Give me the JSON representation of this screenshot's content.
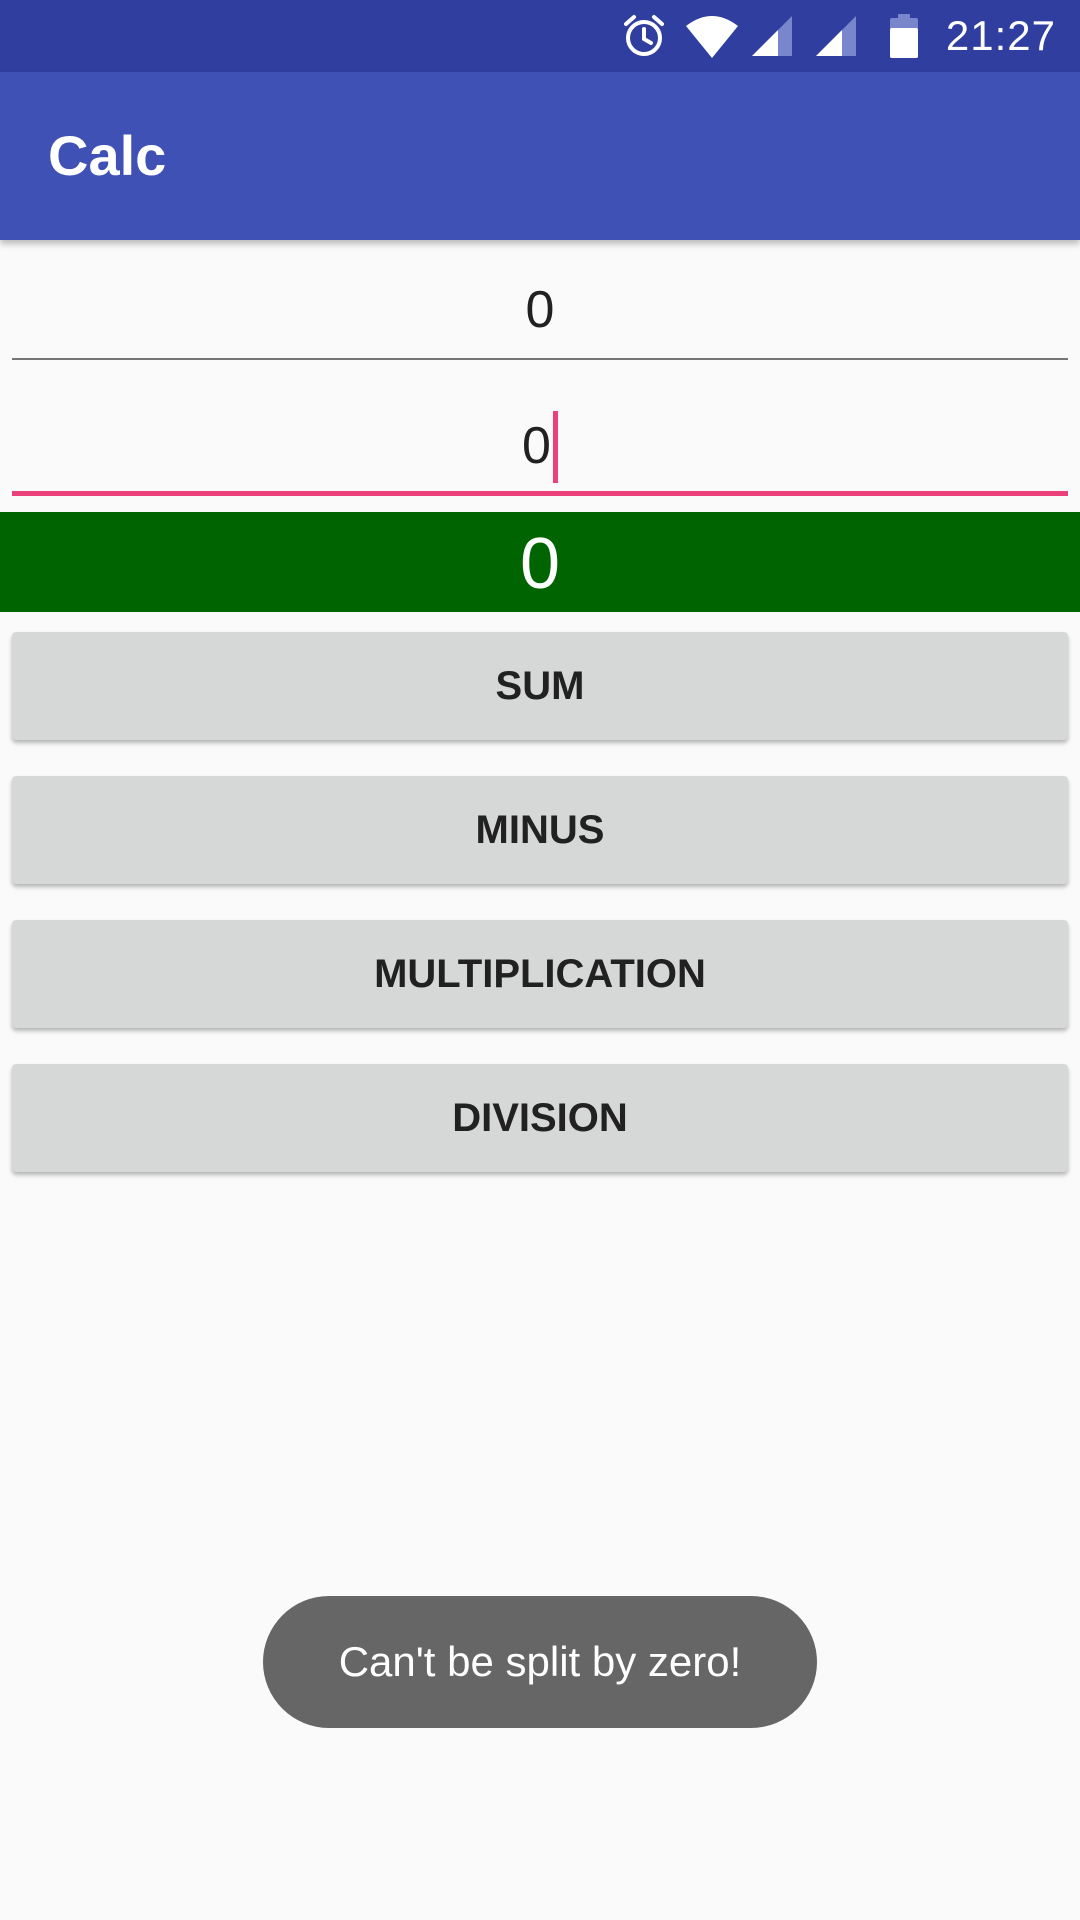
{
  "status_bar": {
    "time": "21:27",
    "icons": [
      "alarm-icon",
      "wifi-icon",
      "signal-icon",
      "signal-icon",
      "battery-icon"
    ],
    "background_color": "#303f9f"
  },
  "app_bar": {
    "title": "Calc",
    "background_color": "#3f51b5"
  },
  "inputs": {
    "first_value": "0",
    "second_value": "0"
  },
  "result": {
    "value": "0",
    "background_color": "#006400"
  },
  "buttons": {
    "sum": "SUM",
    "minus": "MINUS",
    "multiplication": "MULTIPLICATION",
    "division": "DIVISION"
  },
  "toast": {
    "message": "Can't be split by zero!"
  },
  "colors": {
    "accent": "#ec407a",
    "background": "#fafafa",
    "button": "#d6d7d7"
  }
}
